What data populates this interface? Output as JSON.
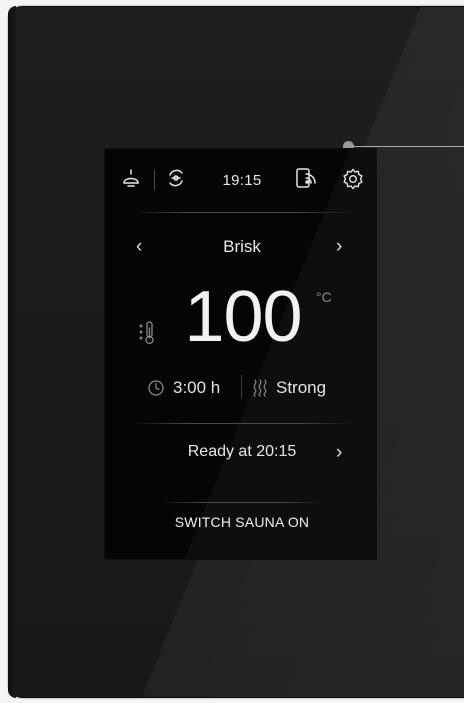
{
  "status_bar": {
    "time": "19:15"
  },
  "mode": {
    "label": "Brisk"
  },
  "temperature": {
    "value": "100",
    "unit": "°C"
  },
  "duration": {
    "value": "3:00 h"
  },
  "intensity": {
    "label": "Strong"
  },
  "ready": {
    "label": "Ready at 20:15"
  },
  "action": {
    "label": "SWITCH SAUNA ON"
  },
  "icons": [
    "lamp-icon",
    "fan-icon",
    "phone-wifi-icon",
    "settings-gear-icon",
    "thermometer-icon",
    "clock-icon",
    "heat-waves-icon",
    "chevron-left-icon",
    "chevron-right-icon"
  ],
  "colors": {
    "panel": "#1c1c1c",
    "screen": "#050505",
    "text": "#e8e8e8",
    "muted": "#8a8a8a",
    "indicator": "#9a9a9a"
  }
}
